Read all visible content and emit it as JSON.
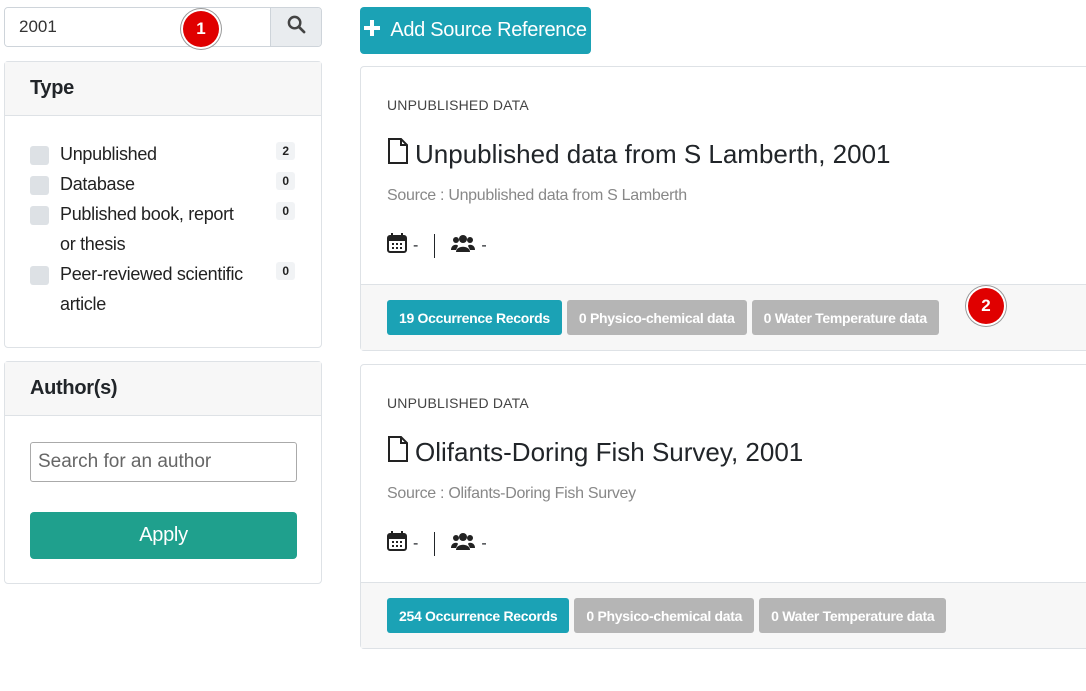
{
  "sidebar": {
    "search": {
      "value": "2001"
    },
    "type_filter": {
      "title": "Type",
      "items": [
        {
          "label": "Unpublished",
          "count": "2"
        },
        {
          "label": "Database",
          "count": "0"
        },
        {
          "label": "Published book, report or thesis",
          "count": "0"
        },
        {
          "label": "Peer-reviewed scientific article",
          "count": "0"
        }
      ]
    },
    "author_filter": {
      "title": "Author(s)",
      "placeholder": "Search for an author",
      "apply_label": "Apply"
    }
  },
  "main": {
    "add_button_label": "Add Source Reference",
    "references": [
      {
        "type": "UNPUBLISHED DATA",
        "title": "Unpublished data from S Lamberth, 2001",
        "source": "Source : Unpublished data from S Lamberth",
        "date": "-",
        "authors": "-",
        "badges": {
          "occurrence": "19 Occurrence Records",
          "physico": "0 Physico-chemical data",
          "water": "0 Water Temperature data"
        }
      },
      {
        "type": "UNPUBLISHED DATA",
        "title": "Olifants-Doring Fish Survey, 2001",
        "source": "Source : Olifants-Doring Fish Survey",
        "date": "-",
        "authors": "-",
        "badges": {
          "occurrence": "254 Occurrence Records",
          "physico": "0 Physico-chemical data",
          "water": "0 Water Temperature data"
        }
      }
    ]
  },
  "annotations": {
    "marker1": "1",
    "marker2": "2"
  },
  "colors": {
    "accent": "#1ba2b5",
    "apply": "#1fa08d",
    "muted_badge": "#b5b5b5",
    "marker": "#e00000"
  },
  "icons": [
    "search-icon",
    "plus-icon",
    "file-icon",
    "calendar-icon",
    "users-icon"
  ]
}
